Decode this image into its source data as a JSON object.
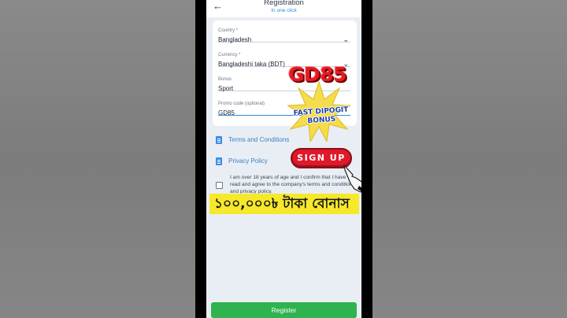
{
  "header": {
    "title": "Registration",
    "subtitle": "In one click"
  },
  "form": {
    "country": {
      "label": "Country *",
      "value": "Bangladesh"
    },
    "currency": {
      "label": "Currency *",
      "value": "Bangladeshi taka (BDT)"
    },
    "bonus": {
      "label": "Bonus",
      "value": "Sport"
    },
    "promo": {
      "label": "Promo code (optional)",
      "value": "GD85"
    }
  },
  "links": {
    "terms": "Terms and Conditions",
    "privacy": "Privacy Policy"
  },
  "consent": {
    "text": "I am over 18 years of age and I confirm that I have read and agree to the company's terms and conditions and privacy policy."
  },
  "overlay": {
    "brand": "GD85",
    "burst_line1": "FAST DIPOGIT",
    "burst_line2": "BONUS",
    "signup": "SIGN UP",
    "banner": "১০০,০০০৳ টাকা বোনাস"
  },
  "register_label": "Register",
  "colors": {
    "accent": "#2e8be0",
    "register": "#2eb34f",
    "banner": "#f6e82a",
    "signup": "#e0192a",
    "brand_red": "#e51b23"
  },
  "icons": {
    "back": "arrow-left-icon",
    "chevron": "chevron-down-icon",
    "document": "document-icon"
  }
}
